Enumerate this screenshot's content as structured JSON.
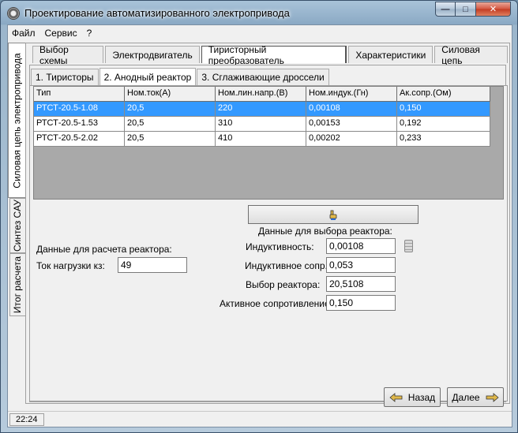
{
  "window": {
    "title": "Проектирование автоматизированного электропривода"
  },
  "menu": {
    "items": [
      "Файл",
      "Сервис",
      "?"
    ]
  },
  "side_tabs": [
    "Силовая цепь электропривода",
    "Синтез САУ",
    "Итог расчета"
  ],
  "main_tabs": [
    "Выбор схемы",
    "Электродвигатель",
    "Тиристорный преобразователь",
    "Характеристики",
    "Силовая цепь"
  ],
  "sub_tabs": [
    "1. Тиристоры",
    "2. Анодный реактор",
    "3. Сглаживающие дроссели"
  ],
  "table": {
    "columns": [
      "Тип",
      "Ном.ток(А)",
      "Ном.лин.напр.(В)",
      "Ном.индук.(Гн)",
      "Ак.сопр.(Ом)"
    ],
    "rows": [
      [
        "РТСТ-20.5-1.08",
        "20,5",
        "220",
        "0,00108",
        "0,150"
      ],
      [
        "РТСТ-20.5-1.53",
        "20,5",
        "310",
        "0,00153",
        "0,192"
      ],
      [
        "РТСТ-20.5-2.02",
        "20,5",
        "410",
        "0,00202",
        "0,233"
      ]
    ],
    "selected_row": 0
  },
  "calc_section": {
    "title": "Данные для расчета реактора:",
    "load_current_label": "Ток нагрузки кз:",
    "load_current_value": "49"
  },
  "selection_section": {
    "title": "Данные для выбора реактора:",
    "inductance_label": "Индуктивность:",
    "inductance_value": "0,00108",
    "inductive_resistance_label": "Индуктивное сопр.:",
    "inductive_resistance_value": "0,053",
    "reactor_choice_label": "Выбор реактора:",
    "reactor_choice_value": "20,5108",
    "active_resistance_label": "Активное сопротивление:",
    "active_resistance_value": "0,150"
  },
  "nav": {
    "back_label": "Назад",
    "next_label": "Далее"
  },
  "status": {
    "time": "22:24"
  },
  "icons": {
    "app": "gear-icon",
    "calc_button": "pointing-hand-icon",
    "calculator": "calculator-icon"
  },
  "colors": {
    "selection": "#3399ff",
    "close_button": "#c33b22"
  }
}
